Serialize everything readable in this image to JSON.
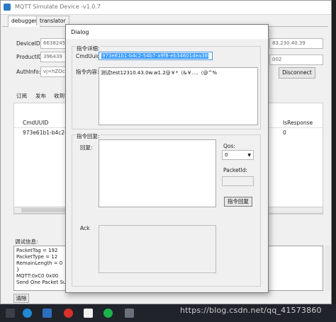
{
  "window": {
    "title": "MQTT Simulate Device  -v1.0.7",
    "tabs": [
      "debugger",
      "translator"
    ]
  },
  "device": {
    "device_id_label": "DeviceID:",
    "device_id_value": "663824596",
    "product_id_label": "ProductID:",
    "product_id_value": "396439",
    "auth_info_label": "AuthInfo:",
    "auth_info_value": "vj=hZOcQ",
    "server_ip_fragment": "83.230.40.39",
    "server_port_fragment": "002",
    "disconnect_label": "Disconnect"
  },
  "inner_tabs": [
    "订阅",
    "发布",
    "收到命"
  ],
  "commands_table": {
    "columns": [
      "CmdUUID",
      "IsResponse"
    ],
    "rows": [
      [
        "973e61b1-b4c2-54b7",
        "0"
      ]
    ]
  },
  "debug": {
    "label": "调试信息:",
    "lines": [
      "PacketTag = 192",
      "PacketType = 12",
      "RemainLength = 0",
      "}",
      "MQTT:0xC0 0x00",
      "Send One Packet Succ:"
    ],
    "clear_label": "清除"
  },
  "dialog": {
    "title": "Dialog",
    "detail_group": "指令详细:",
    "cmd_uuid_label": "CmdUuid:",
    "cmd_uuid_value": "973e61b1-b4c2-54b7-a9f8-eb34601dea38",
    "content_label": "指令内容:",
    "content_value": "测试test12310.43.0w.w1.2@￥*（&￥....（@^%",
    "reply_group": "指令回复:",
    "reply_label": "回复:",
    "qos_label": "Qos:",
    "qos_value": "0",
    "packet_id_label": "PacketId:",
    "reply_button": "指令回复",
    "ack_label": "Ack"
  },
  "watermark": "https://blog.csdn.net/qq_41573860",
  "colors": {
    "selection": "#3399ff",
    "taskbar": "#20232a"
  }
}
